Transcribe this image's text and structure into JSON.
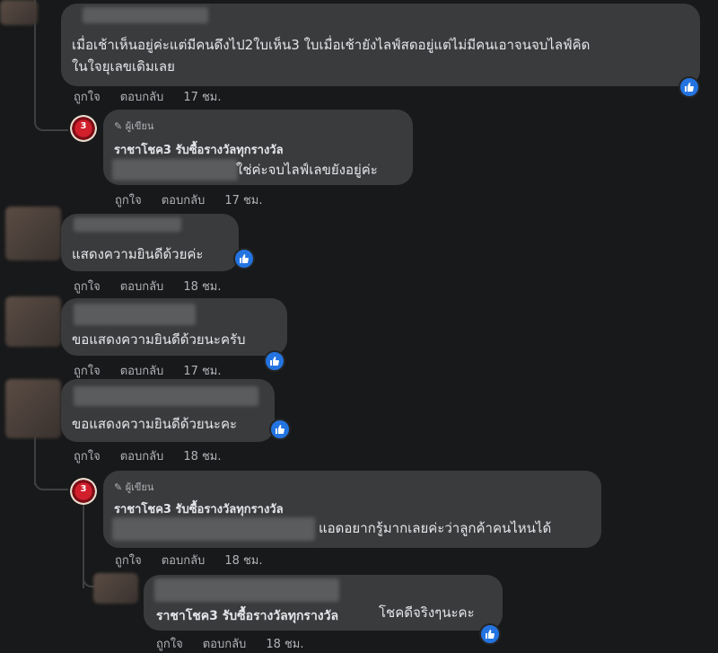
{
  "comments": [
    {
      "text1": "เมื่อเช้าเห็นอยู่ค่ะแต่มีคนดึงไป2ใบเห็น3 ใบเมื่อเช้ายังไลฟ์สดอยู่แต่ไม่มีคนเอาจนจบไลฟ์คิด",
      "text2": "ในใจยุเลขเดิมเลย",
      "like": "ถูกใจ",
      "reply": "ตอบกลับ",
      "time": "17 ชม."
    },
    {
      "badge": "ผู้เขียน",
      "name": "ราชาโชค3 รับซื้อรางวัลทุกรางวัล",
      "avatar_text": "3",
      "text": "ใช่ค่ะจบไลฟ์เลขยังอยู่ค่ะ",
      "like": "ถูกใจ",
      "reply": "ตอบกลับ",
      "time": "17 ชม."
    },
    {
      "text": "แสดงความยินดีด้วยค่ะ",
      "like": "ถูกใจ",
      "reply": "ตอบกลับ",
      "time": "18 ชม."
    },
    {
      "text": "ขอแสดงความยินดีด้วยนะครับ",
      "like": "ถูกใจ",
      "reply": "ตอบกลับ",
      "time": "17 ชม."
    },
    {
      "text": "ขอแสดงความยินดีด้วยนะคะ",
      "like": "ถูกใจ",
      "reply": "ตอบกลับ",
      "time": "18 ชม."
    },
    {
      "badge": "ผู้เขียน",
      "name": "ราชาโชค3 รับซื้อรางวัลทุกรางวัล",
      "avatar_text": "3",
      "text": "แอดอยากรู้มากเลยค่ะว่าลูกค้าคนไหนได้",
      "like": "ถูกใจ",
      "reply": "ตอบกลับ",
      "time": "18 ชม."
    },
    {
      "name": "ราชาโชค3 รับซื้อรางวัลทุกรางวัล",
      "text": "โชคดีจริงๆนะคะ",
      "like": "ถูกใจ",
      "reply": "ตอบกลับ",
      "time": "18 ชม."
    }
  ],
  "colors": {
    "background": "#18191a",
    "bubble": "#3a3b3c",
    "like_badge": "#2374e1"
  },
  "icons": {
    "like": "thumbs-up-icon",
    "author": "pencil-icon"
  }
}
